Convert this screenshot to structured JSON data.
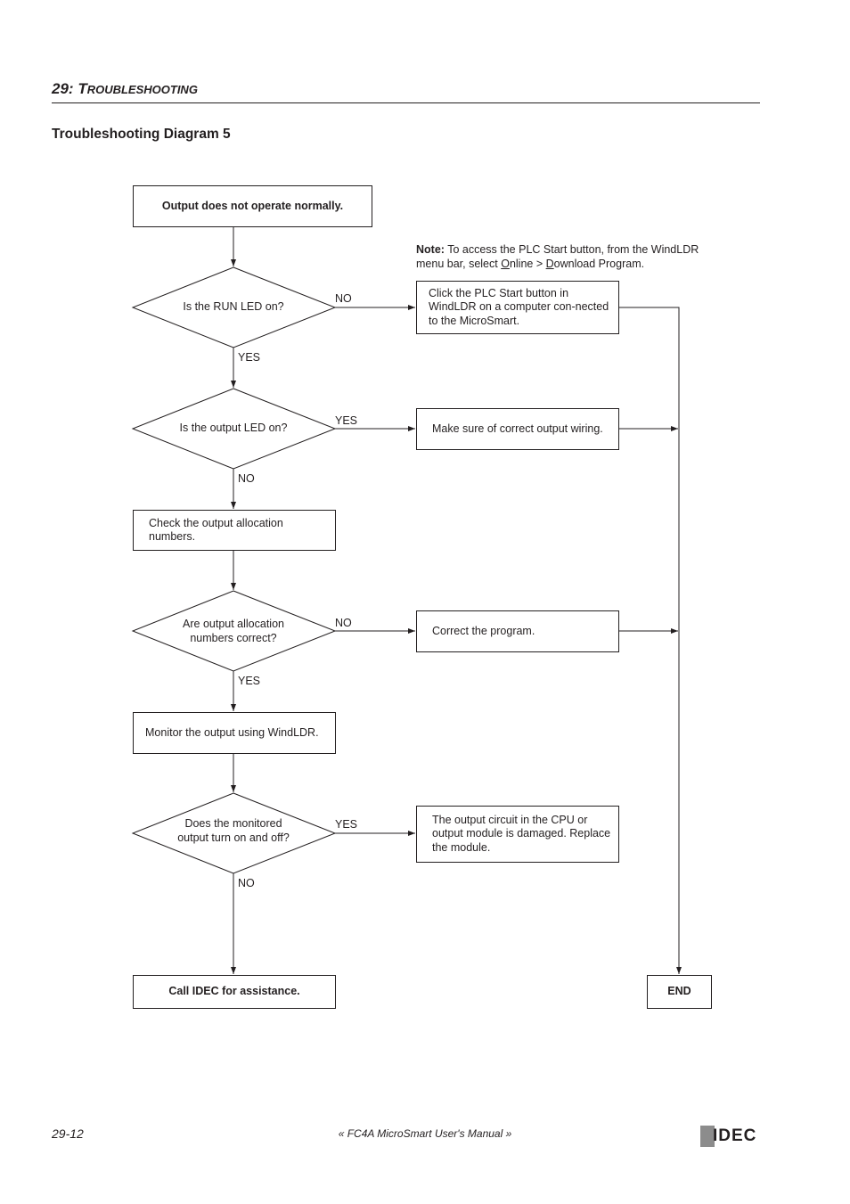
{
  "header": {
    "chapter_number": "29:",
    "chapter_title": "Troubleshooting",
    "section_title": "Troubleshooting Diagram 5"
  },
  "note": {
    "label": "Note:",
    "text_1": " To access the PLC Start button, from the WindLDR menu bar, select ",
    "menu_1_first": "O",
    "menu_1_rest": "nline",
    "separator": " > ",
    "menu_2_first": "D",
    "menu_2_rest": "ownload Program",
    "end": "."
  },
  "flowchart": {
    "start": "Output does not operate normally.",
    "decisions": [
      {
        "id": "run-led",
        "text": "Is the RUN LED on?",
        "right_label": "NO",
        "down_label": "YES"
      },
      {
        "id": "output-led",
        "text": "Is the output LED on?",
        "right_label": "YES",
        "down_label": "NO"
      },
      {
        "id": "allocation",
        "text": "Are output allocation numbers correct?",
        "right_label": "NO",
        "down_label": "YES"
      },
      {
        "id": "monitored",
        "text": "Does the monitored output turn on and off?",
        "right_label": "YES",
        "down_label": "NO"
      }
    ],
    "actions": {
      "plc_start": "Click the PLC Start button in WindLDR on a computer con-nected to the MicroSmart.",
      "wiring": "Make sure of correct output wiring.",
      "check_allocation": "Check the output allocation numbers.",
      "correct_program": "Correct the program.",
      "monitor": "Monitor the output using WindLDR.",
      "damaged": "The output circuit in the CPU or output module is damaged. Replace the module.",
      "call_idec": "Call IDEC for assistance.",
      "end": "END"
    }
  },
  "footer": {
    "page": "29-12",
    "manual_title": "« FC4A MicroSmart User's Manual »",
    "logo": "IDEC"
  }
}
